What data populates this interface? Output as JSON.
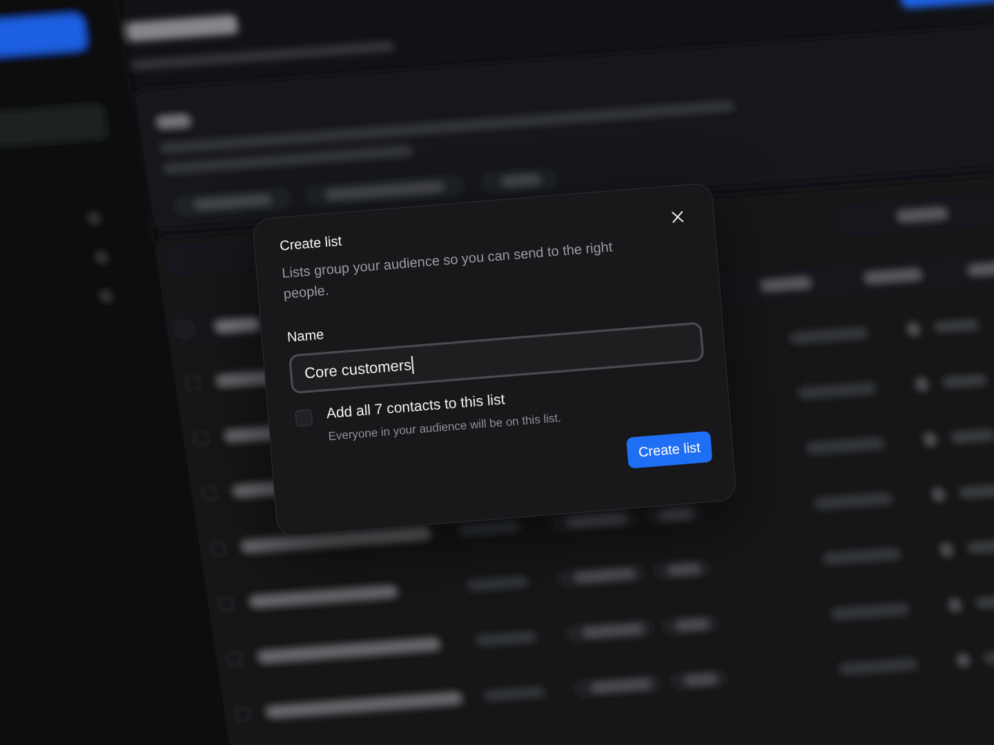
{
  "dialog": {
    "title": "Create list",
    "description": "Lists group your audience so you can send to the right people.",
    "name_field": {
      "label": "Name",
      "value": "Core customers",
      "focused": true
    },
    "add_all": {
      "label": "Add all 7 contacts to this list",
      "hint": "Everyone in your audience will be on this list.",
      "checked": false
    },
    "primary_button": {
      "label": "Create list"
    }
  }
}
